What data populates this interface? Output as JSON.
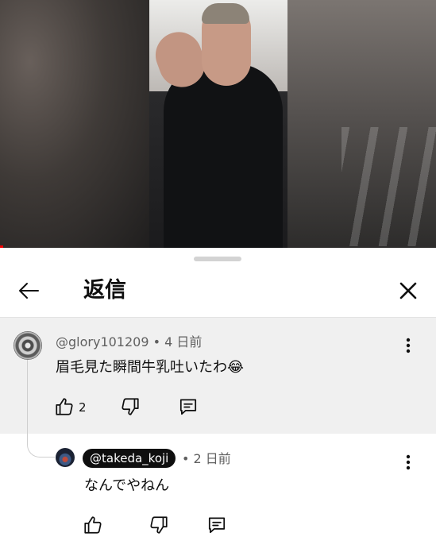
{
  "sheet": {
    "title": "返信"
  },
  "parent_comment": {
    "handle": "@glory101209",
    "time": "• 4 日前",
    "text": "眉毛見た瞬間牛乳吐いたわ😂",
    "like_count": "2"
  },
  "reply": {
    "mention": "@takeda_koji",
    "time": "• 2 日前",
    "text": "なんでやねん"
  },
  "icons": [
    "back-arrow-icon",
    "close-icon",
    "more-vert-icon",
    "thumb-up-icon",
    "thumb-down-icon",
    "reply-icon"
  ]
}
